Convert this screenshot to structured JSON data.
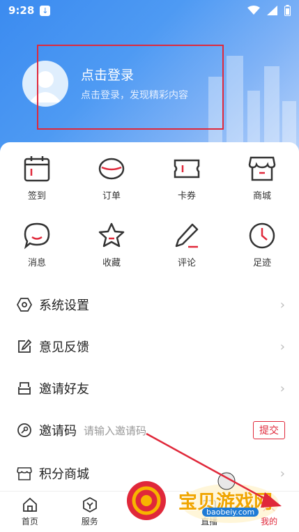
{
  "status_bar": {
    "time": "9:28"
  },
  "profile": {
    "title": "点击登录",
    "subtitle": "点击登录，发现精彩内容"
  },
  "grid": [
    {
      "label": "签到",
      "icon": "calendar-icon"
    },
    {
      "label": "订单",
      "icon": "order-icon"
    },
    {
      "label": "卡券",
      "icon": "ticket-icon"
    },
    {
      "label": "商城",
      "icon": "shop-icon"
    },
    {
      "label": "消息",
      "icon": "message-icon"
    },
    {
      "label": "收藏",
      "icon": "star-icon"
    },
    {
      "label": "评论",
      "icon": "pencil-icon"
    },
    {
      "label": "足迹",
      "icon": "clock-icon"
    }
  ],
  "menu": {
    "settings": "系统设置",
    "feedback": "意见反馈",
    "invite_friends": "邀请好友",
    "invite_code": "邀请码",
    "invite_code_placeholder": "请输入邀请码",
    "submit": "提交",
    "points_mall": "积分商城"
  },
  "tabs": [
    {
      "label": "首页"
    },
    {
      "label": "服务"
    },
    {
      "label": ""
    },
    {
      "label": "直播"
    },
    {
      "label": "我的"
    }
  ],
  "watermark": {
    "text": "宝贝游戏网",
    "url": "baobeiy.com"
  },
  "colors": {
    "accent": "#e0283a",
    "hero_blue": "#3b8bf0"
  }
}
